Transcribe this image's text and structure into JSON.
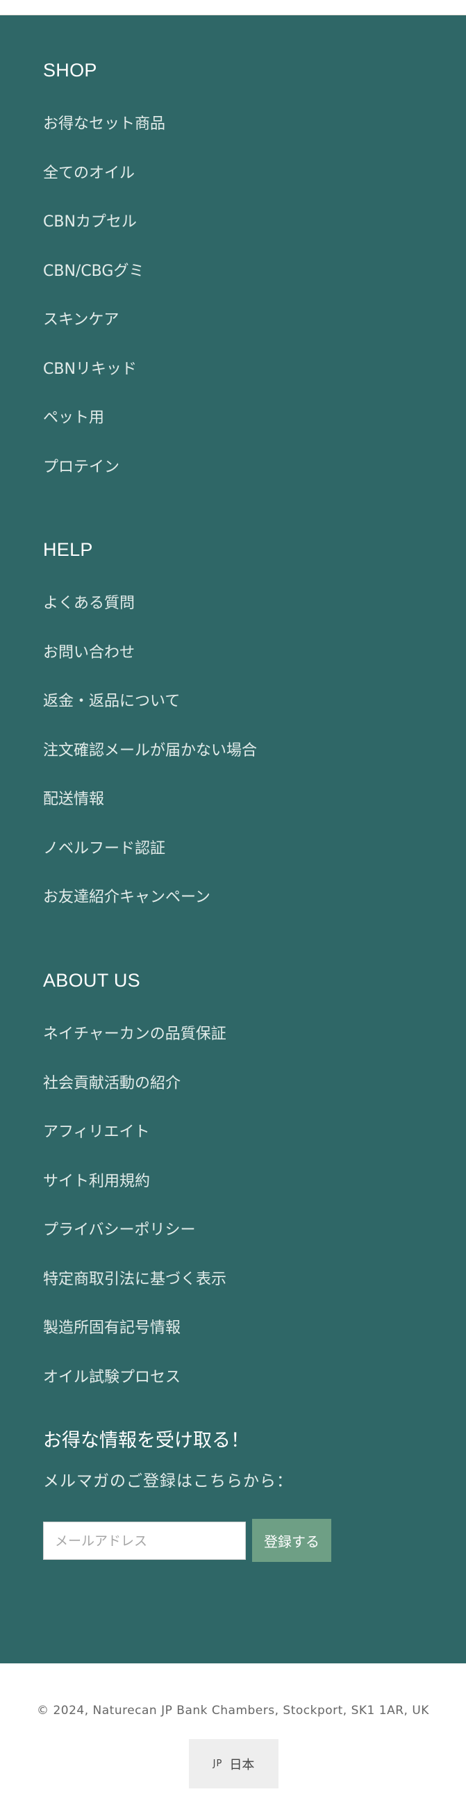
{
  "shop": {
    "title": "SHOP",
    "links": [
      "お得なセット商品",
      "全てのオイル",
      "CBNカプセル",
      "CBN/CBGグミ",
      "スキンケア",
      "CBNリキッド",
      "ペット用",
      "プロテイン"
    ]
  },
  "help": {
    "title": "HELP",
    "links": [
      "よくある質問",
      "お問い合わせ",
      "返金・返品について",
      "注文確認メールが届かない場合",
      "配送情報",
      "ノベルフード認証",
      "お友達紹介キャンペーン"
    ]
  },
  "about": {
    "title": "ABOUT US",
    "links": [
      "ネイチャーカンの品質保証",
      "社会貢献活動の紹介",
      "アフィリエイト",
      "サイト利用規約",
      "プライバシーポリシー",
      "特定商取引法に基づく表示",
      "製造所固有記号情報",
      "オイル試験プロセス"
    ]
  },
  "newsletter": {
    "title": "お得な情報を受け取る！",
    "subtitle": "メルマガのご登録はこちらから：",
    "email_placeholder": "メールアドレス",
    "submit_label": "登録する"
  },
  "bottom": {
    "copyright": "© 2024, Naturecan JP Bank Chambers, Stockport, SK1 1AR, UK",
    "country_code": "JP",
    "country_name": "日本"
  },
  "colors": {
    "footer_bg": "#2f6767",
    "button_bg": "#6e9f85",
    "selector_bg": "#eeeeee"
  }
}
